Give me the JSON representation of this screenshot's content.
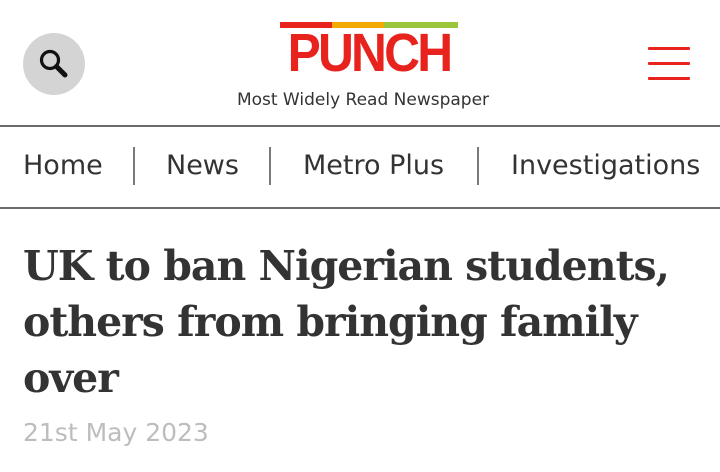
{
  "header": {
    "logo_text": "PUNCH",
    "tagline": "Most Widely Read Newspaper",
    "search_icon": "search-icon",
    "menu_icon": "hamburger-menu-icon",
    "brand_color": "#e8221c"
  },
  "nav": {
    "items": [
      {
        "label": "Home"
      },
      {
        "label": "News"
      },
      {
        "label": "Metro Plus"
      },
      {
        "label": "Investigations"
      }
    ]
  },
  "article": {
    "headline": "UK to ban Nigerian students, others from bringing family over",
    "date": "21st May 2023"
  }
}
